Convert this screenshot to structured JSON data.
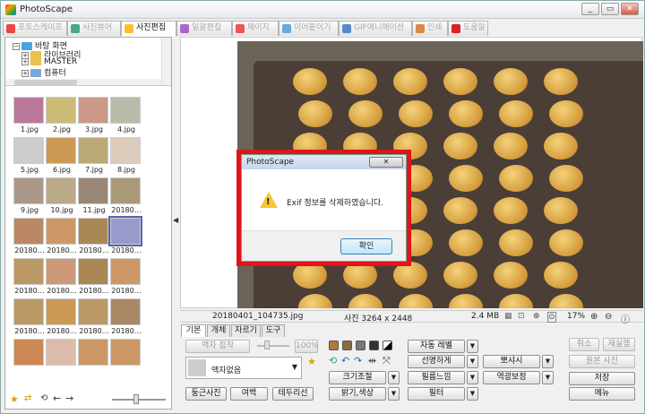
{
  "window": {
    "title": "PhotoScape",
    "minimize": "_",
    "restore": "▭",
    "close": "✕"
  },
  "tabs": [
    {
      "label": "포토스케이프",
      "color": "#e44"
    },
    {
      "label": "사진뷰어",
      "color": "#4a8"
    },
    {
      "label": "사진편집",
      "color": "#fb3"
    },
    {
      "label": "일괄편집",
      "color": "#a6c"
    },
    {
      "label": "페이지",
      "color": "#e55"
    },
    {
      "label": "이어붙이기",
      "color": "#6ad"
    },
    {
      "label": "GIF애니메이션",
      "color": "#58c"
    },
    {
      "label": "인쇄",
      "color": "#d84"
    },
    {
      "label": "도움말",
      "color": "#d22"
    }
  ],
  "tree": [
    {
      "label": "바탕 화면",
      "expander": "−"
    },
    {
      "label": "라이브러리",
      "expander": "+"
    },
    {
      "label": "MASTER",
      "expander": "+"
    },
    {
      "label": "컴퓨터",
      "expander": "+"
    }
  ],
  "thumbnails": [
    {
      "name": "1.jpg",
      "color": "#b79"
    },
    {
      "name": "2.jpg",
      "color": "#cb7"
    },
    {
      "name": "3.jpg",
      "color": "#c98"
    },
    {
      "name": "4.jpg",
      "color": "#bba"
    },
    {
      "name": "5.jpg",
      "color": "#ccc"
    },
    {
      "name": "6.jpg",
      "color": "#c95"
    },
    {
      "name": "7.jpg",
      "color": "#ba7"
    },
    {
      "name": "8.jpg",
      "color": "#dcb"
    },
    {
      "name": "9.jpg",
      "color": "#a98"
    },
    {
      "name": "10.jpg",
      "color": "#ba8"
    },
    {
      "name": "11.jpg",
      "color": "#987"
    },
    {
      "name": "20180…",
      "color": "#a97"
    },
    {
      "name": "20180…",
      "color": "#b86"
    },
    {
      "name": "20180…",
      "color": "#c96"
    },
    {
      "name": "20180…",
      "color": "#a85"
    },
    {
      "name": "20180…",
      "color": "#99c"
    },
    {
      "name": "20180…",
      "color": "#b96"
    },
    {
      "name": "20180…",
      "color": "#c97"
    },
    {
      "name": "20180…",
      "color": "#a85"
    },
    {
      "name": "20180…",
      "color": "#c96"
    },
    {
      "name": "20180…",
      "color": "#b96"
    },
    {
      "name": "20180…",
      "color": "#c95"
    },
    {
      "name": "20180…",
      "color": "#b96"
    },
    {
      "name": "20180…",
      "color": "#a86"
    },
    {
      "name": "",
      "color": "#c85"
    },
    {
      "name": "",
      "color": "#dba"
    },
    {
      "name": "",
      "color": "#c96"
    },
    {
      "name": "",
      "color": "#c96"
    }
  ],
  "status": {
    "filename": "20180401_104735.jpg",
    "size": "사진 3264 x 2448",
    "filesize": "2.4 MB",
    "zoom": "17%"
  },
  "control_tabs": [
    "기본",
    "개체",
    "자르기",
    "도구"
  ],
  "controls": {
    "frame_merge": "액자 접착",
    "frame_percent": "100%",
    "frame_select": "액자없음",
    "round_photo": "둥근사진",
    "margin": "여백",
    "border": "테두리선",
    "auto_level": "자동 레벨",
    "sharpen": "선명하게",
    "film": "필름느낌",
    "filter": "필터",
    "resize": "크기조절",
    "brightness": "밝기,색상",
    "bloom": "뽀샤시",
    "backlight": "역광보정",
    "cancel": "취소",
    "redo": "재실행",
    "original": "원본 사진",
    "save": "저장",
    "menu": "메뉴"
  },
  "dialog": {
    "title": "PhotoScape",
    "message": "Exif 정보를 삭제하였습니다.",
    "ok": "확인",
    "close": "✕",
    "icon": "warning-icon",
    "highlight_color": "#e1131b"
  }
}
